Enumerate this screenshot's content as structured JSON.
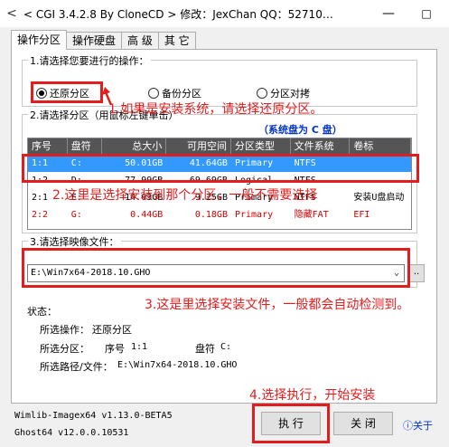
{
  "window": {
    "title": "< CGI 3.4.2.8 By CloneCD > 修改：JexChan  QQ：52710…",
    "minimize": "—",
    "maximize": "□"
  },
  "tabs": [
    "操作分区",
    "操作硬盘",
    "高  级",
    "其  它"
  ],
  "section1": {
    "title": "1.请选择您要进行的操作：",
    "options": [
      "还原分区",
      "备份分区",
      "分区对拷"
    ],
    "selected_index": 0
  },
  "section2": {
    "title": "2.请选择分区（用鼠标左键单击）",
    "system_disk_link": "（系统盘为 C 盘）",
    "headers": [
      "序号",
      "盘符",
      "总大小",
      "可用空间",
      "分区类型",
      "文件系统",
      "卷标"
    ],
    "rows": [
      [
        "1:1",
        "C:",
        "50.01GB",
        "41.64GB",
        "Primary",
        "NTFS",
        ""
      ],
      [
        "1:2",
        "D:",
        "77.99GB",
        "69.69GB",
        "Logical",
        "NTFS",
        ""
      ],
      [
        "2:1",
        "E:",
        "14.03GB",
        "9.25GB",
        "Primary",
        "NTFS",
        "安装U盘启动"
      ],
      [
        "2:2",
        "G:",
        "0.44GB",
        "0.18GB",
        "Primary",
        "隐藏FAT",
        "EFI"
      ]
    ]
  },
  "section3": {
    "title": "3.请选择映像文件：",
    "value": "E:\\Win7x64-2018.10.GHO",
    "browse": ".."
  },
  "status": {
    "title": "状态：",
    "operation_label": "所选操作：",
    "operation_value": "还原分区",
    "partition_label": "所选分区：",
    "index_label": "序号",
    "index_value": "1:1",
    "drive_label": "盘符",
    "drive_value": "C:",
    "path_label": "所选路径/文件：",
    "path_value": "E:\\Win7x64-2018.10.GHO"
  },
  "footer": {
    "wimlib": "Wimlib-Imagex64 v1.13.0-BETA5",
    "ghost": "Ghost64 v12.0.0.10531",
    "execute": "执 行",
    "close": "关 闭",
    "about": "关于"
  },
  "annotations": {
    "a1": "1.如果是安装系统，请选择还原分区。",
    "a2": "2.这里是选择安装到那个分区，一般不需要选择",
    "a3": "3.这是里选择安装文件，一般都会自动检测到。",
    "a4": "4.选择执行，开始安装"
  },
  "colors": {
    "annotation_red": "#e31d1d",
    "selection_blue": "#3399ff",
    "link_blue": "#0033cc",
    "header_gray": "#555555"
  }
}
